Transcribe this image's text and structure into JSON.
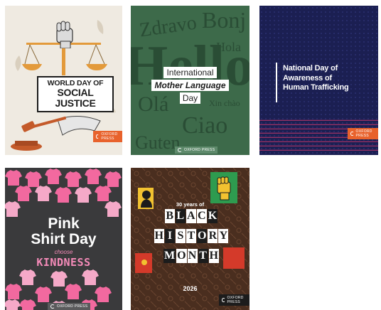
{
  "cards": [
    {
      "name": "World Day of Social Justice",
      "line1": "WORLD DAY OF",
      "line2": "SOCIAL JUSTICE",
      "logo": "OXFORD PRESS",
      "colors": {
        "bg": "#efeae1",
        "accent": "#e8622c",
        "scale": "#e39a3b"
      },
      "icons": [
        "raised-fist-icon",
        "balance-scale-icon",
        "gavel-icon",
        "hand-icon"
      ]
    },
    {
      "name": "International Mother Language Day",
      "line1": "International",
      "line2": "Mother Language",
      "line3": "Day",
      "bg_words": [
        "Zdravo",
        "Bonj",
        "Hello",
        "Olá",
        "Ciao",
        "Guten",
        "Xin chào",
        "Hola"
      ],
      "logo": "OXFORD PRESS",
      "colors": {
        "bg": "#3d6a4a",
        "text": "#2a4d35"
      }
    },
    {
      "name": "National Day of Awareness of Human Trafficking",
      "text_lines": [
        "National Day of",
        "Awareness of",
        "Human Trafficking"
      ],
      "logo": "OXFORD PRESS",
      "colors": {
        "bg": "#1b1f52",
        "accent": "#e8622c",
        "pattern": "#c0376a"
      }
    },
    {
      "name": "Pink Shirt Day",
      "line1": "Pink",
      "line2": "Shirt Day",
      "choose": "choose",
      "kindness": "KINDNESS",
      "logo": "OXFORD PRESS",
      "colors": {
        "bg": "#3a3a3c",
        "pink": "#f2699f",
        "light_pink": "#f5a9c8"
      },
      "icons": [
        "t-shirt-icon"
      ]
    },
    {
      "name": "Black History Month",
      "years": "30 years of",
      "word1": [
        "B",
        "L",
        "A",
        "C",
        "K"
      ],
      "word2": [
        "H",
        "I",
        "S",
        "T",
        "O",
        "R",
        "Y"
      ],
      "word3": [
        "M",
        "O",
        "N",
        "T",
        "H"
      ],
      "year": "2026",
      "logo": "OXFORD PRESS",
      "colors": {
        "bg": "#4a2e1f",
        "green": "#2e9b4f",
        "yellow": "#f2c230",
        "red": "#d43a2a"
      },
      "icons": [
        "raised-fist-icon",
        "silhouette-icon",
        "flower-icon"
      ]
    }
  ]
}
